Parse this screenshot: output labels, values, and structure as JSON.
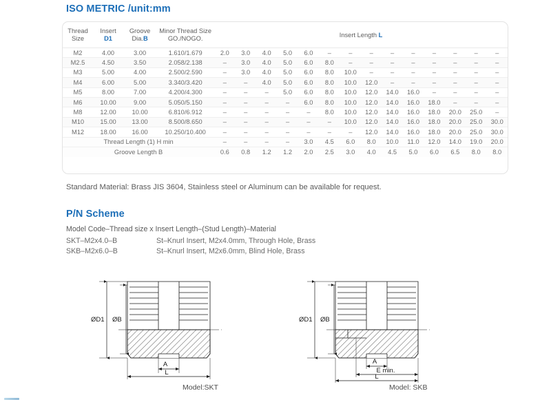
{
  "sections": {
    "iso_heading": "ISO METRIC /unit:mm",
    "pn_heading": "P/N Scheme"
  },
  "colors": {
    "heading_blue": "#1d6fb8",
    "body_gray": "#5a5a5a",
    "table_text": "#6d6d6d",
    "card_border": "#e3e3e3",
    "row_divider": "#efefef",
    "drawing_line": "#1a1a1a"
  },
  "table": {
    "headers": {
      "thread_size": "Thread\nSize",
      "thread_size_l1": "Thread",
      "thread_size_l2": "Size",
      "insert_l1": "Insert",
      "insert_l2": "D1",
      "groove_l1": "Groove",
      "groove_l2a": "Dia.",
      "groove_l2b": "B",
      "minor_l1": "Minor Thread Size",
      "minor_l2": "GO./NOGO.",
      "insert_length_a": "Insert",
      "insert_length_b": "Length",
      "insert_length_c": "L"
    },
    "rows": [
      {
        "thread": "M2",
        "d1": "4.00",
        "b": "3.00",
        "minor": "1.610/1.679",
        "lengths": [
          "2.0",
          "3.0",
          "4.0",
          "5.0",
          "6.0",
          "–",
          "–",
          "–",
          "–",
          "–",
          "–",
          "–",
          "–",
          "–"
        ]
      },
      {
        "thread": "M2.5",
        "d1": "4.50",
        "b": "3.50",
        "minor": "2.058/2.138",
        "lengths": [
          "–",
          "3.0",
          "4.0",
          "5.0",
          "6.0",
          "8.0",
          "–",
          "–",
          "–",
          "–",
          "–",
          "–",
          "–",
          "–"
        ]
      },
      {
        "thread": "M3",
        "d1": "5.00",
        "b": "4.00",
        "minor": "2.500/2.590",
        "lengths": [
          "–",
          "3.0",
          "4.0",
          "5.0",
          "6.0",
          "8.0",
          "10.0",
          "–",
          "–",
          "–",
          "–",
          "–",
          "–",
          "–"
        ]
      },
      {
        "thread": "M4",
        "d1": "6.00",
        "b": "5.00",
        "minor": "3.340/3.420",
        "lengths": [
          "–",
          "–",
          "4.0",
          "5.0",
          "6.0",
          "8.0",
          "10.0",
          "12.0",
          "–",
          "–",
          "–",
          "–",
          "–",
          "–"
        ]
      },
      {
        "thread": "M5",
        "d1": "8.00",
        "b": "7.00",
        "minor": "4.200/4.300",
        "lengths": [
          "–",
          "–",
          "–",
          "5.0",
          "6.0",
          "8.0",
          "10.0",
          "12.0",
          "14.0",
          "16.0",
          "–",
          "–",
          "–",
          "–"
        ]
      },
      {
        "thread": "M6",
        "d1": "10.00",
        "b": "9.00",
        "minor": "5.050/5.150",
        "lengths": [
          "–",
          "–",
          "–",
          "–",
          "6.0",
          "8.0",
          "10.0",
          "12.0",
          "14.0",
          "16.0",
          "18.0",
          "–",
          "–",
          "–"
        ]
      },
      {
        "thread": "M8",
        "d1": "12.00",
        "b": "10.00",
        "minor": "6.810/6.912",
        "lengths": [
          "–",
          "–",
          "–",
          "–",
          "–",
          "8.0",
          "10.0",
          "12.0",
          "14.0",
          "16.0",
          "18.0",
          "20.0",
          "25.0",
          "–"
        ]
      },
      {
        "thread": "M10",
        "d1": "15.00",
        "b": "13.00",
        "minor": "8.500/8.650",
        "lengths": [
          "–",
          "–",
          "–",
          "–",
          "–",
          "–",
          "10.0",
          "12.0",
          "14.0",
          "16.0",
          "18.0",
          "20.0",
          "25.0",
          "30.0"
        ]
      },
      {
        "thread": "M12",
        "d1": "18.00",
        "b": "16.00",
        "minor": "10.250/10.400",
        "lengths": [
          "–",
          "–",
          "–",
          "–",
          "–",
          "–",
          "–",
          "12.0",
          "14.0",
          "16.0",
          "18.0",
          "20.0",
          "25.0",
          "30.0"
        ]
      }
    ],
    "summary_rows": [
      {
        "label": "Thread Length (1) H min",
        "values": [
          "–",
          "–",
          "–",
          "–",
          "3.0",
          "4.5",
          "6.0",
          "8.0",
          "10.0",
          "11.0",
          "12.0",
          "14.0",
          "19.0",
          "20.0"
        ]
      },
      {
        "label": "Groove Length B",
        "values": [
          "0.6",
          "0.8",
          "1.2",
          "1.2",
          "2.0",
          "2.5",
          "3.0",
          "4.0",
          "4.5",
          "5.0",
          "6.0",
          "6.5",
          "8.0",
          "8.0"
        ]
      }
    ]
  },
  "notes": {
    "material": "Standard Material: Brass JIS 3604, Stainless steel or Aluminum can be available for request."
  },
  "pn_scheme": {
    "formula": "Model Code–Thread size x Insert Length–(Stud Length)–Material",
    "examples": [
      {
        "code": "SKT–M2x4.0–B",
        "description": "St–Knurl Insert, M2x4.0mm, Through Hole, Brass"
      },
      {
        "code": "SKB–M2x6.0–B",
        "description": "St–Knurl Insert, M2x6.0mm, Blind Hole, Brass"
      }
    ]
  },
  "drawings": {
    "skt": {
      "caption": "Model:SKT",
      "dim_d1": "ØD1",
      "dim_b": "ØB",
      "dim_a": "A",
      "dim_l": "L"
    },
    "skb": {
      "caption": "Model: SKB",
      "dim_d1": "ØD1",
      "dim_b": "ØB",
      "dim_a": "A",
      "dim_e": "E min.",
      "dim_l": "L"
    }
  }
}
